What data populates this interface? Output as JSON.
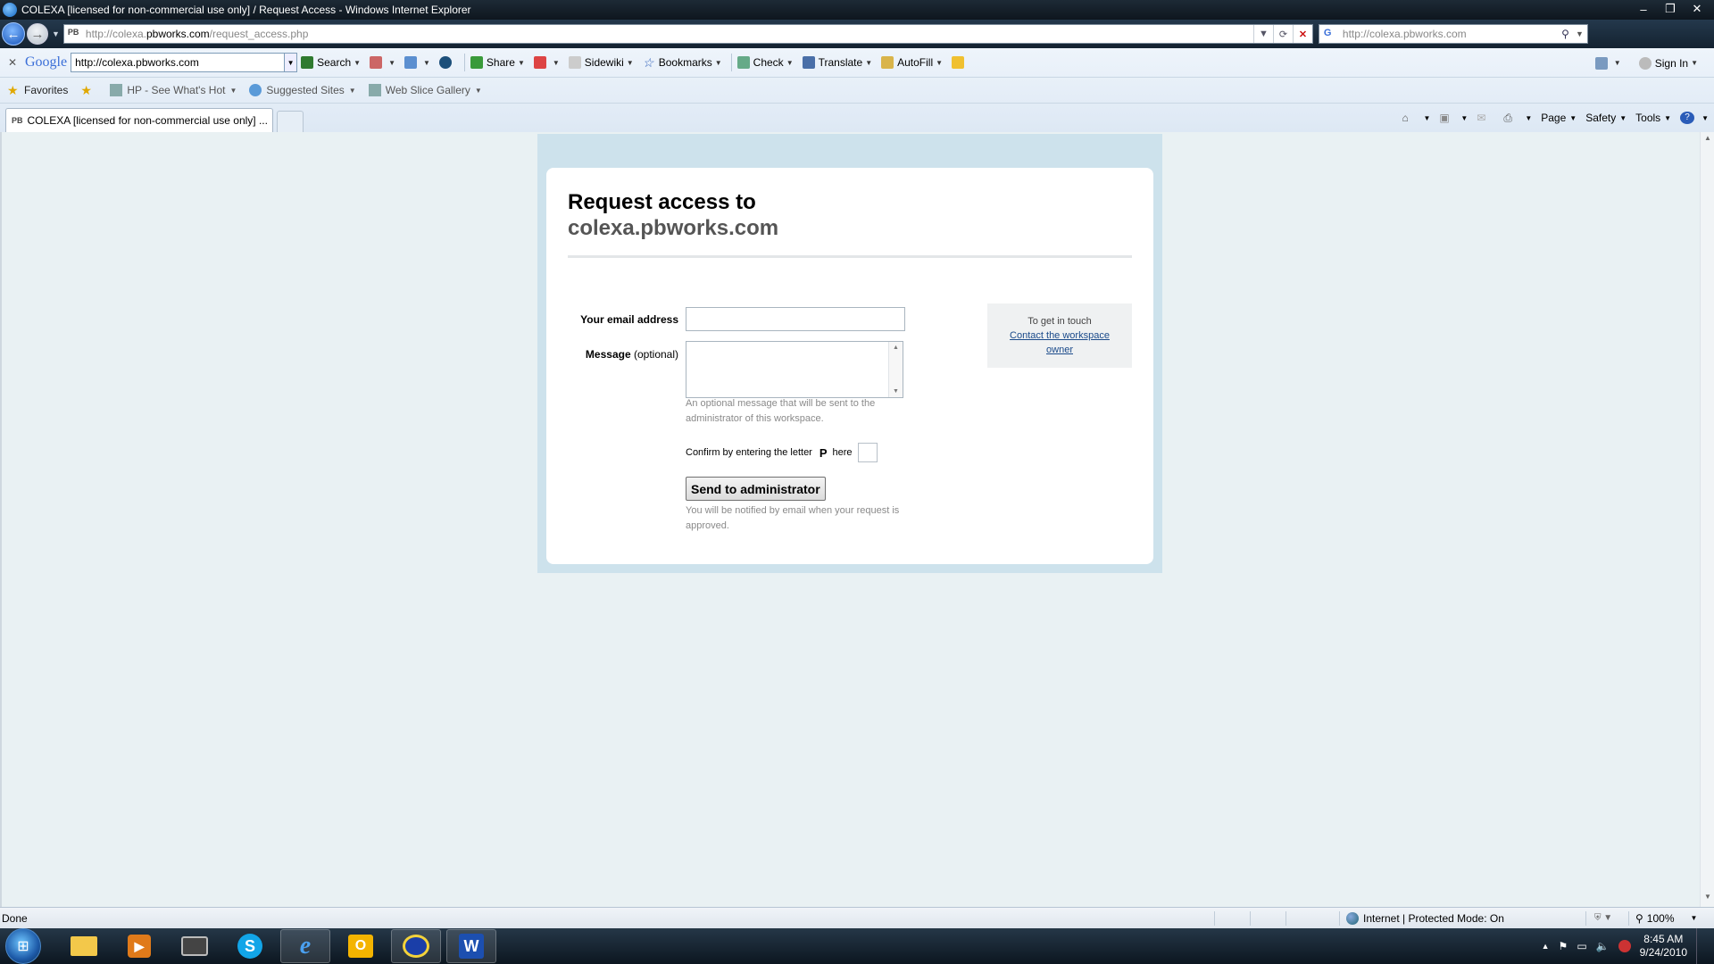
{
  "window": {
    "title": "COLEXA [licensed for non-commercial use only] / Request Access - Windows Internet Explorer",
    "buttons": [
      "–",
      "❐",
      "✕"
    ]
  },
  "address_bar": {
    "url_prefix": "http://colexa.",
    "url_host": "pbworks.com",
    "url_path": "/request_access.php",
    "favicon": "PB",
    "search_text": "http://colexa.pbworks.com"
  },
  "google_toolbar": {
    "logo": "Google",
    "input_value": "http://colexa.pbworks.com",
    "items": [
      "Search",
      "Share",
      "Sidewiki",
      "Bookmarks",
      "Check",
      "Translate",
      "AutoFill"
    ],
    "sign_in": "Sign In"
  },
  "favorites_bar": {
    "favorites": "Favorites",
    "items": [
      "HP - See What's Hot",
      "Suggested Sites",
      "Web Slice Gallery"
    ]
  },
  "tabs": {
    "active_tab": "COLEXA [licensed for non-commercial use only] ...",
    "favicon": "PB"
  },
  "command_bar": [
    "Page",
    "Safety",
    "Tools"
  ],
  "page": {
    "heading_line1": "Request access to",
    "heading_line2": "colexa.pbworks.com",
    "email_label": "Your email address",
    "message_label": "Message",
    "message_optional": "(optional)",
    "message_hint_line1": "An optional message that will be sent to the",
    "message_hint_line2": "administrator of this workspace.",
    "confirm_prefix": "Confirm by entering the letter",
    "confirm_letter": "P",
    "confirm_suffix": "here",
    "submit_label": "Send to administrator",
    "notify_line1": "You will be notified by email when your request is",
    "notify_line2": "approved.",
    "side_title": "To get in touch",
    "side_link": "Contact the workspace owner"
  },
  "status_bar": {
    "status": "Done",
    "zone": "Internet | Protected Mode: On",
    "zoom": "100%"
  },
  "taskbar": {
    "time": "8:45 AM",
    "date": "9/24/2010"
  }
}
